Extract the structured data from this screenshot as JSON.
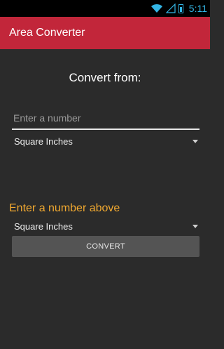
{
  "status_bar": {
    "time": "5:11",
    "icons": [
      "wifi-icon",
      "signal-icon",
      "battery-icon"
    ],
    "accent_color": "#33b5e5"
  },
  "action_bar": {
    "title": "Area Converter",
    "color": "#c2263a"
  },
  "main": {
    "heading": "Convert from:",
    "input": {
      "value": "",
      "placeholder": "Enter a number"
    },
    "from_unit": {
      "selected": "Square Inches"
    },
    "result": "Enter a number above",
    "result_color": "#f0a830",
    "to_unit": {
      "selected": "Square Inches"
    },
    "convert_label": "CONVERT"
  }
}
